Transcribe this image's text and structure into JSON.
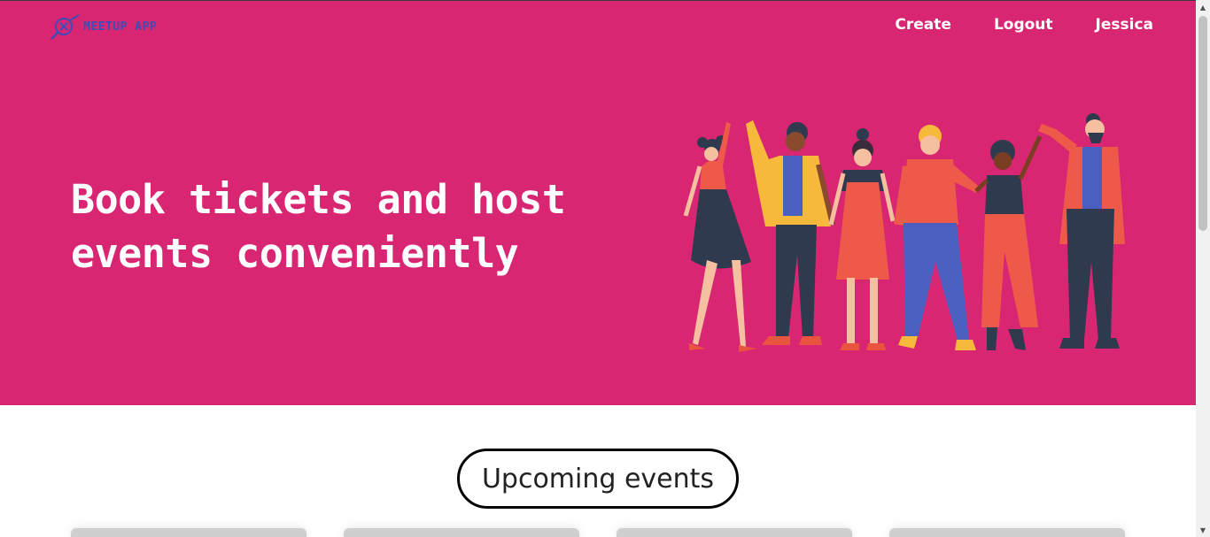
{
  "header": {
    "logo_text": "MEETUP APP",
    "nav": {
      "create": "Create",
      "logout": "Logout",
      "user": "Jessica"
    }
  },
  "hero": {
    "headline_line1": "Book tickets and host",
    "headline_line2": "events conveniently",
    "background_color": "#d92672",
    "illustration_icon": "people-group-illustration"
  },
  "main": {
    "section_title": "Upcoming events",
    "event_cards_visible": 4
  },
  "scrollbar": {
    "up_icon": "scroll-up-arrow-icon",
    "down_icon": "scroll-down-arrow-icon"
  }
}
